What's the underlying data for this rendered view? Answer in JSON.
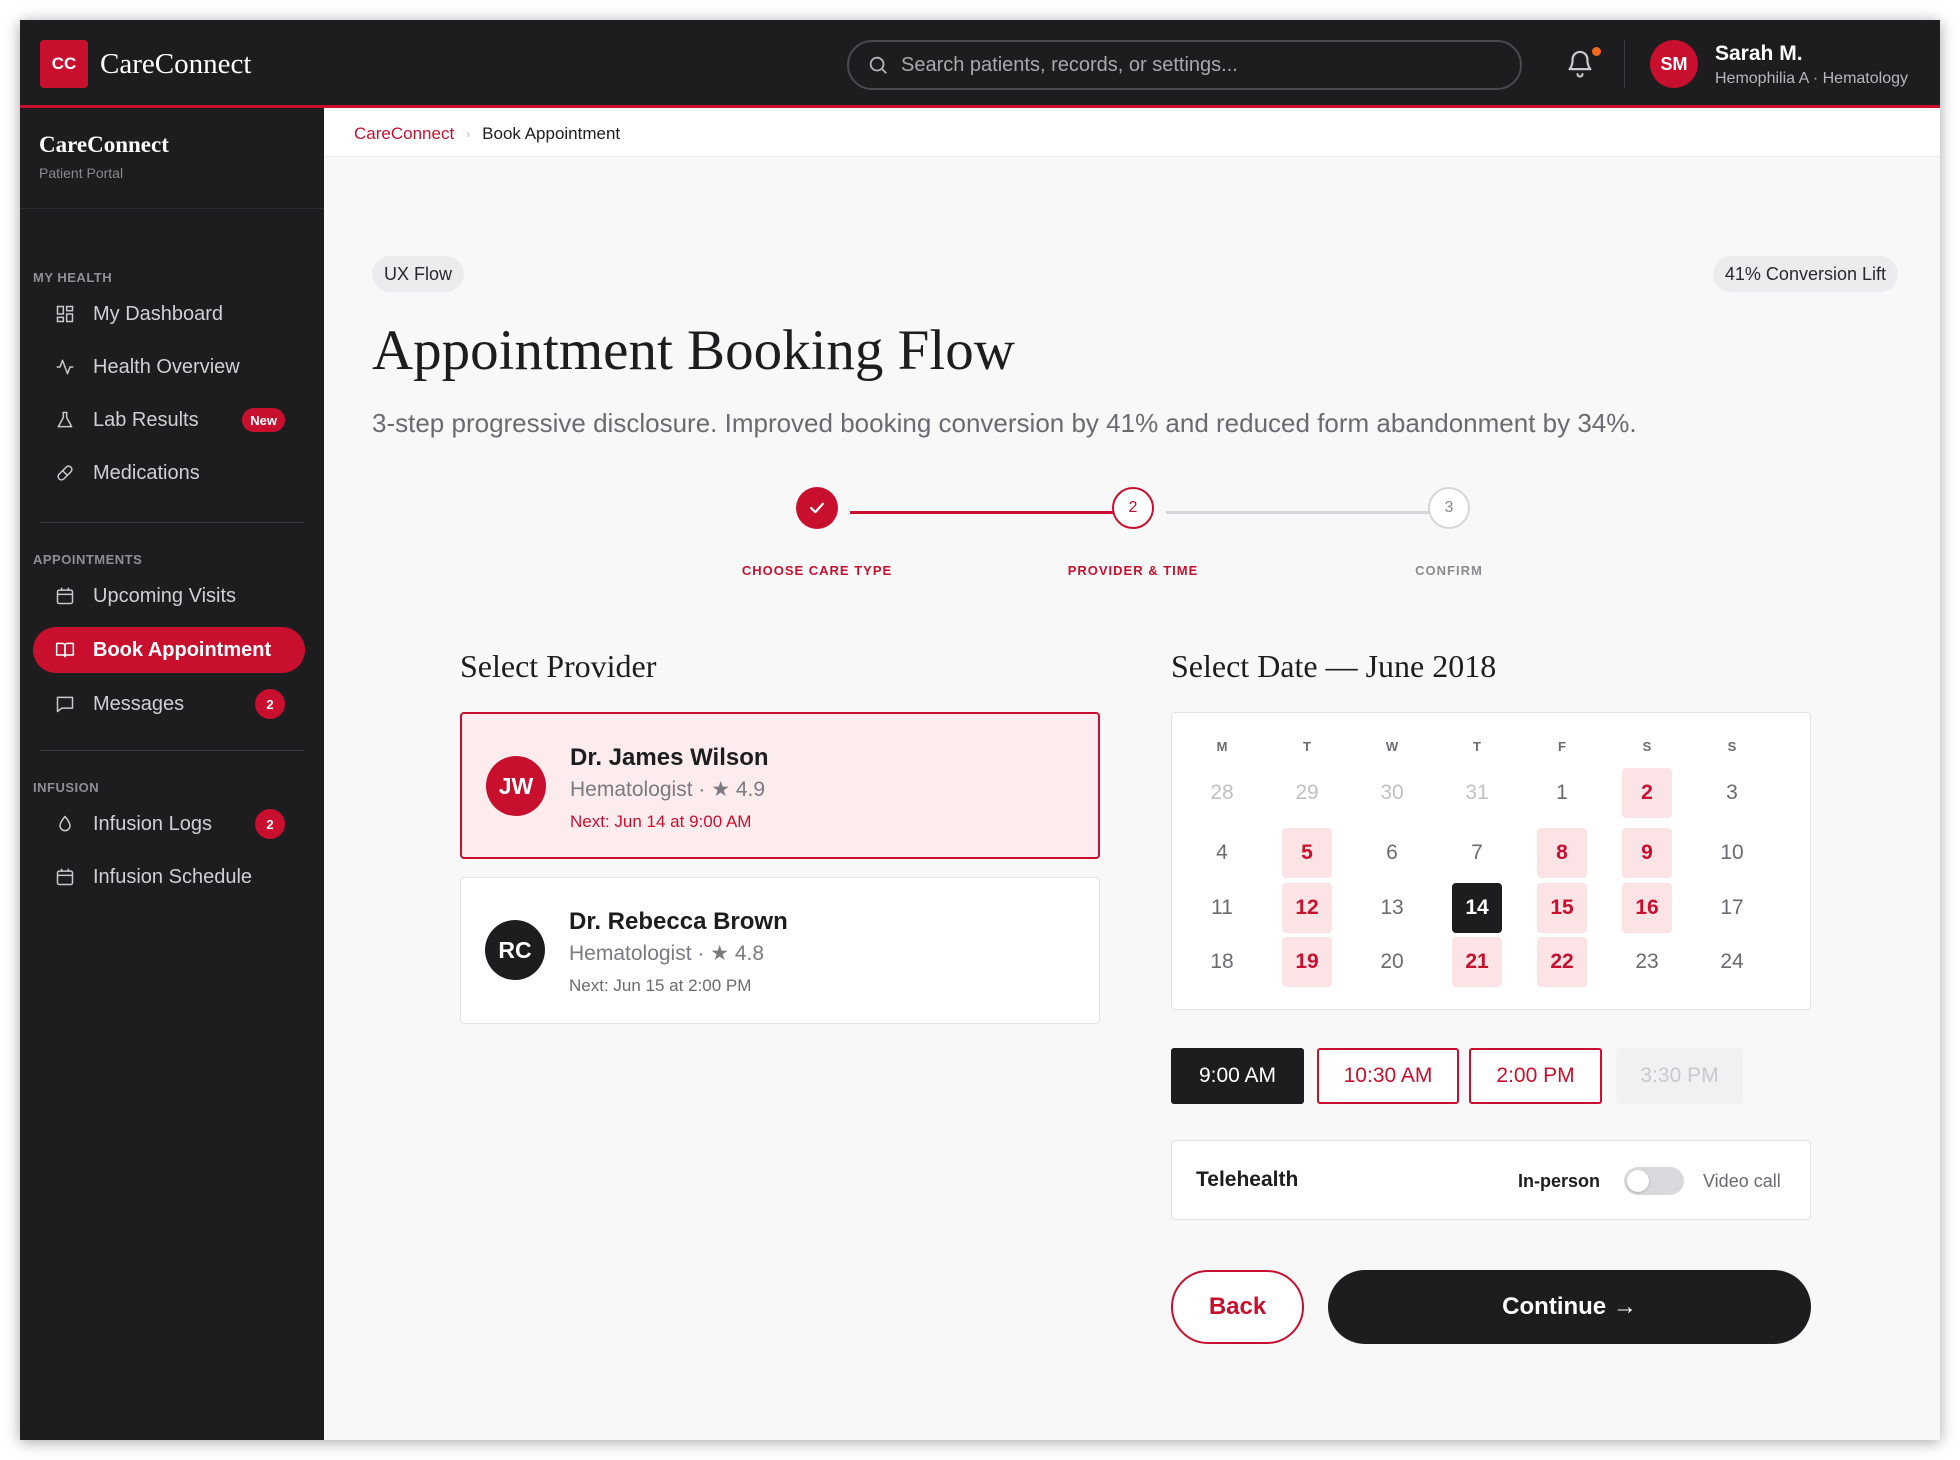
{
  "topbar": {
    "logo_initials": "CC",
    "app_title": "CareConnect",
    "search_placeholder": "Search patients, records, or settings...",
    "user": {
      "initials": "SM",
      "name": "Sarah M.",
      "subtitle": "Hemophilia A · Hematology"
    }
  },
  "sidebar": {
    "brand": "CareConnect",
    "brand_sub": "Patient Portal",
    "sections": [
      {
        "title": "MY HEALTH",
        "items": [
          {
            "label": "My Dashboard",
            "icon": "grid-icon"
          },
          {
            "label": "Health Overview",
            "icon": "activity-icon"
          },
          {
            "label": "Lab Results",
            "icon": "flask-icon",
            "badge": "New"
          },
          {
            "label": "Medications",
            "icon": "pill-icon"
          }
        ]
      },
      {
        "title": "APPOINTMENTS",
        "items": [
          {
            "label": "Upcoming Visits",
            "icon": "calendar-clock-icon"
          },
          {
            "label": "Book Appointment",
            "icon": "book-icon",
            "active": true
          },
          {
            "label": "Messages",
            "icon": "message-icon",
            "badge": "2"
          }
        ]
      },
      {
        "title": "INFUSION",
        "items": [
          {
            "label": "Infusion Logs",
            "icon": "droplet-icon",
            "badge": "2"
          },
          {
            "label": "Infusion Schedule",
            "icon": "calendar-icon"
          }
        ]
      }
    ]
  },
  "breadcrumb": {
    "root": "CareConnect",
    "current": "Book Appointment"
  },
  "main": {
    "tag_left": "UX Flow",
    "tag_right": "41% Conversion Lift",
    "title": "Appointment Booking Flow",
    "subtitle": "3-step progressive disclosure. Improved booking conversion by 41% and reduced form abandonment by 34%.",
    "steps": [
      {
        "number": "1",
        "label": "CHOOSE CARE TYPE",
        "state": "done"
      },
      {
        "number": "2",
        "label": "PROVIDER & TIME",
        "state": "current"
      },
      {
        "number": "3",
        "label": "CONFIRM",
        "state": "upcoming"
      }
    ],
    "provider_heading": "Select Provider",
    "providers": [
      {
        "initials": "JW",
        "name": "Dr. James Wilson",
        "specialty": "Hematologist · ★ 4.9",
        "next": "Next: Jun 14 at 9:00 AM",
        "selected": true
      },
      {
        "initials": "RC",
        "name": "Dr. Rebecca Brown",
        "specialty": "Hematologist · ★ 4.8",
        "next": "Next: Jun 15 at 2:00 PM",
        "selected": false
      }
    ],
    "date_heading": "Select Date — June 2018",
    "calendar": {
      "weekdays": [
        "M",
        "T",
        "W",
        "T",
        "F",
        "S",
        "S"
      ],
      "weeks": [
        [
          {
            "d": "28",
            "s": "muted"
          },
          {
            "d": "29",
            "s": "muted"
          },
          {
            "d": "30",
            "s": "muted"
          },
          {
            "d": "31",
            "s": "muted"
          },
          {
            "d": "1",
            "s": "normal"
          },
          {
            "d": "2",
            "s": "avail"
          },
          {
            "d": "3",
            "s": "normal"
          }
        ],
        [
          {
            "d": "4",
            "s": "normal"
          },
          {
            "d": "5",
            "s": "avail"
          },
          {
            "d": "6",
            "s": "normal"
          },
          {
            "d": "7",
            "s": "normal"
          },
          {
            "d": "8",
            "s": "avail"
          },
          {
            "d": "9",
            "s": "avail"
          },
          {
            "d": "10",
            "s": "normal"
          }
        ],
        [
          {
            "d": "11",
            "s": "normal"
          },
          {
            "d": "12",
            "s": "avail"
          },
          {
            "d": "13",
            "s": "normal"
          },
          {
            "d": "14",
            "s": "sel"
          },
          {
            "d": "15",
            "s": "avail"
          },
          {
            "d": "16",
            "s": "avail"
          },
          {
            "d": "17",
            "s": "normal"
          }
        ],
        [
          {
            "d": "18",
            "s": "normal"
          },
          {
            "d": "19",
            "s": "avail"
          },
          {
            "d": "20",
            "s": "normal"
          },
          {
            "d": "21",
            "s": "avail"
          },
          {
            "d": "22",
            "s": "avail"
          },
          {
            "d": "23",
            "s": "normal"
          },
          {
            "d": "24",
            "s": "normal"
          }
        ]
      ]
    },
    "times": [
      {
        "label": "9:00 AM",
        "state": "sel"
      },
      {
        "label": "10:30 AM",
        "state": "avail"
      },
      {
        "label": "2:00 PM",
        "state": "avail"
      },
      {
        "label": "3:30 PM",
        "state": "dis"
      }
    ],
    "telehealth": {
      "label": "Telehealth",
      "left_option": "In-person",
      "right_option": "Video call",
      "video": false
    },
    "back_label": "Back",
    "continue_label": "Continue →"
  },
  "colors": {
    "accent": "#c8102e",
    "dark": "#1d1d1f",
    "available_bg": "#fbe3e6",
    "selected_card_bg": "#fdecee"
  }
}
